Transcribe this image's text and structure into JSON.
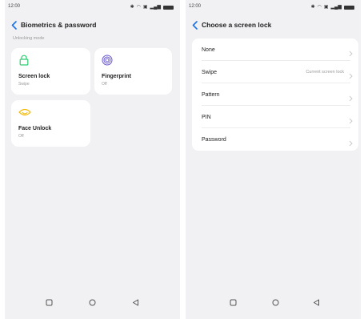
{
  "status_bar": {
    "time": "12:00"
  },
  "left_screen": {
    "title": "Biometrics & password",
    "section_label": "Unlocking mode",
    "tiles": [
      {
        "title": "Screen lock",
        "subtitle": "Swipe",
        "icon": "lock-icon"
      },
      {
        "title": "Fingerprint",
        "subtitle": "Off",
        "icon": "fingerprint-icon"
      },
      {
        "title": "Face Unlock",
        "subtitle": "Off",
        "icon": "face-icon"
      }
    ]
  },
  "right_screen": {
    "title": "Choose a screen lock",
    "options": [
      {
        "label": "None",
        "value": ""
      },
      {
        "label": "Swipe",
        "value": "Current screen lock"
      },
      {
        "label": "Pattern",
        "value": ""
      },
      {
        "label": "PIN",
        "value": ""
      },
      {
        "label": "Password",
        "value": ""
      }
    ]
  },
  "colors": {
    "accent": "#1a73e8",
    "lock_icon": "#2ecc71",
    "fingerprint_icon": "#6a5acd",
    "face_icon": "#f5b800",
    "background": "#f1f1f3"
  },
  "nav_icons": [
    "recent-apps-icon",
    "home-icon",
    "back-icon"
  ]
}
